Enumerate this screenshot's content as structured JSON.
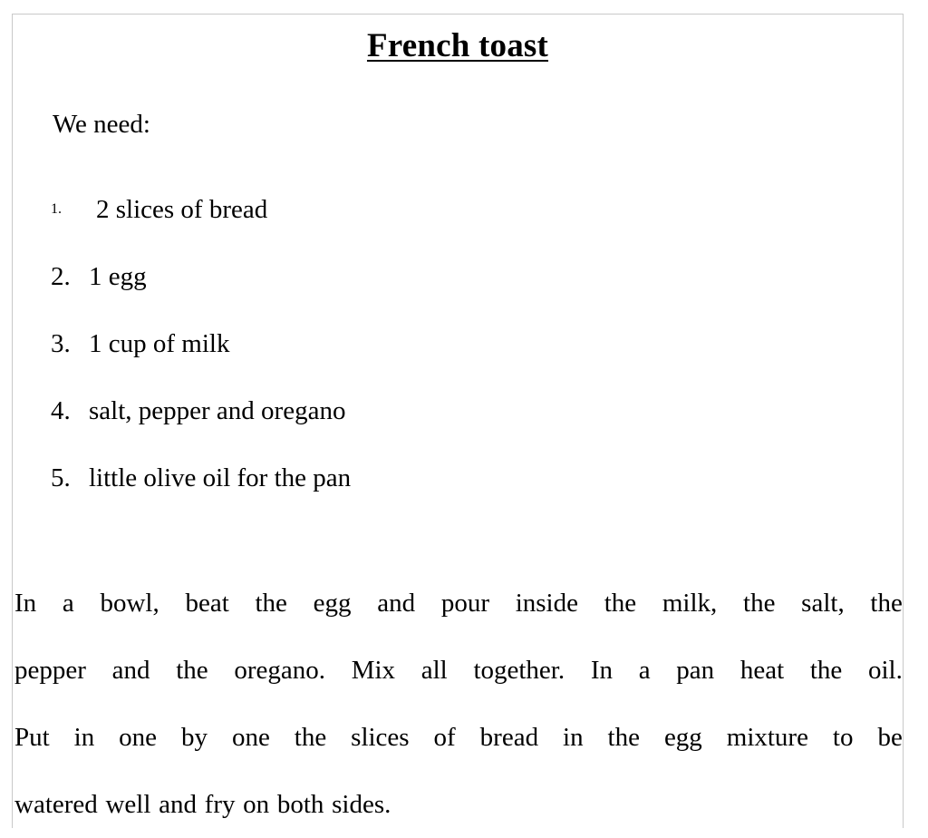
{
  "document": {
    "title": "French toast",
    "intro": "We need:",
    "ingredients": [
      {
        "marker": "1.",
        "text": "2 slices of bread"
      },
      {
        "marker": "2.",
        "text": "1 egg"
      },
      {
        "marker": "3.",
        "text": "1 cup of milk"
      },
      {
        "marker": "4.",
        "text": "salt, pepper and oregano"
      },
      {
        "marker": "5.",
        "text": "little olive oil for the pan"
      }
    ],
    "instructions": {
      "full_text": "In a bowl, beat the egg and pour inside the milk, the salt, the pepper and the oregano. Mix all together. In a pan heat the oil. Put in one by one the slices of bread in the egg mixture to be watered well and fry on both sides.",
      "lines": [
        "In a bowl, beat the egg and pour inside the milk, the salt, the",
        "pepper and the oregano. Mix all together. In a pan heat the oil.",
        "Put in one by one the slices of bread in the egg mixture to be",
        "watered well and fry on both sides."
      ]
    },
    "colors": {
      "text": "#000000",
      "page_background": "#ffffff",
      "page_border": "#c9c9c9"
    }
  }
}
